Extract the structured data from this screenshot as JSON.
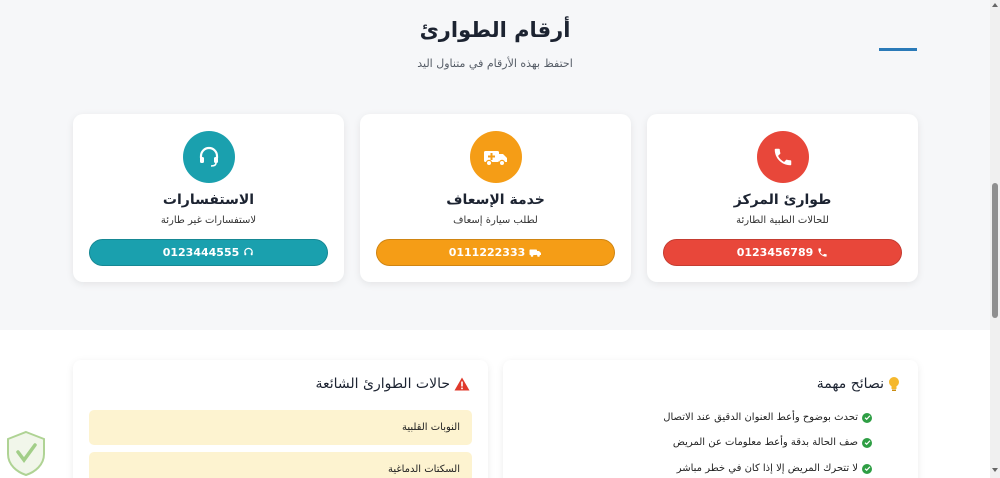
{
  "header": {
    "title": "أرقام الطوارئ",
    "subtitle": "احتفظ بهذه الأرقام في متناول اليد"
  },
  "cards": [
    {
      "title": "طوارئ المركز",
      "description": "للحالات الطبية الطارئة",
      "phone": "0123456789",
      "icon": "phone-icon",
      "color": "#e8473a"
    },
    {
      "title": "خدمة الإسعاف",
      "description": "لطلب سيارة إسعاف",
      "phone": "0111222333",
      "icon": "ambulance-icon",
      "color": "#f59d16"
    },
    {
      "title": "الاستفسارات",
      "description": "لاستفسارات غير طارئة",
      "phone": "0123444555",
      "icon": "headset-icon",
      "color": "#1aa0ae"
    }
  ],
  "emergency_panel": {
    "title": "حالات الطوارئ الشائعة",
    "icon": "warning-icon",
    "items": [
      "النوبات القلبية",
      "السكتات الدماغية"
    ]
  },
  "tips_panel": {
    "title": "نصائح مهمة",
    "icon": "lightbulb-icon",
    "items": [
      "تحدث بوضوح وأعط العنوان الدقيق عند الاتصال",
      "صف الحالة بدقة وأعط معلومات عن المريض",
      "لا تتحرك المريض إلا إذا كان في خطر مباشر"
    ]
  }
}
